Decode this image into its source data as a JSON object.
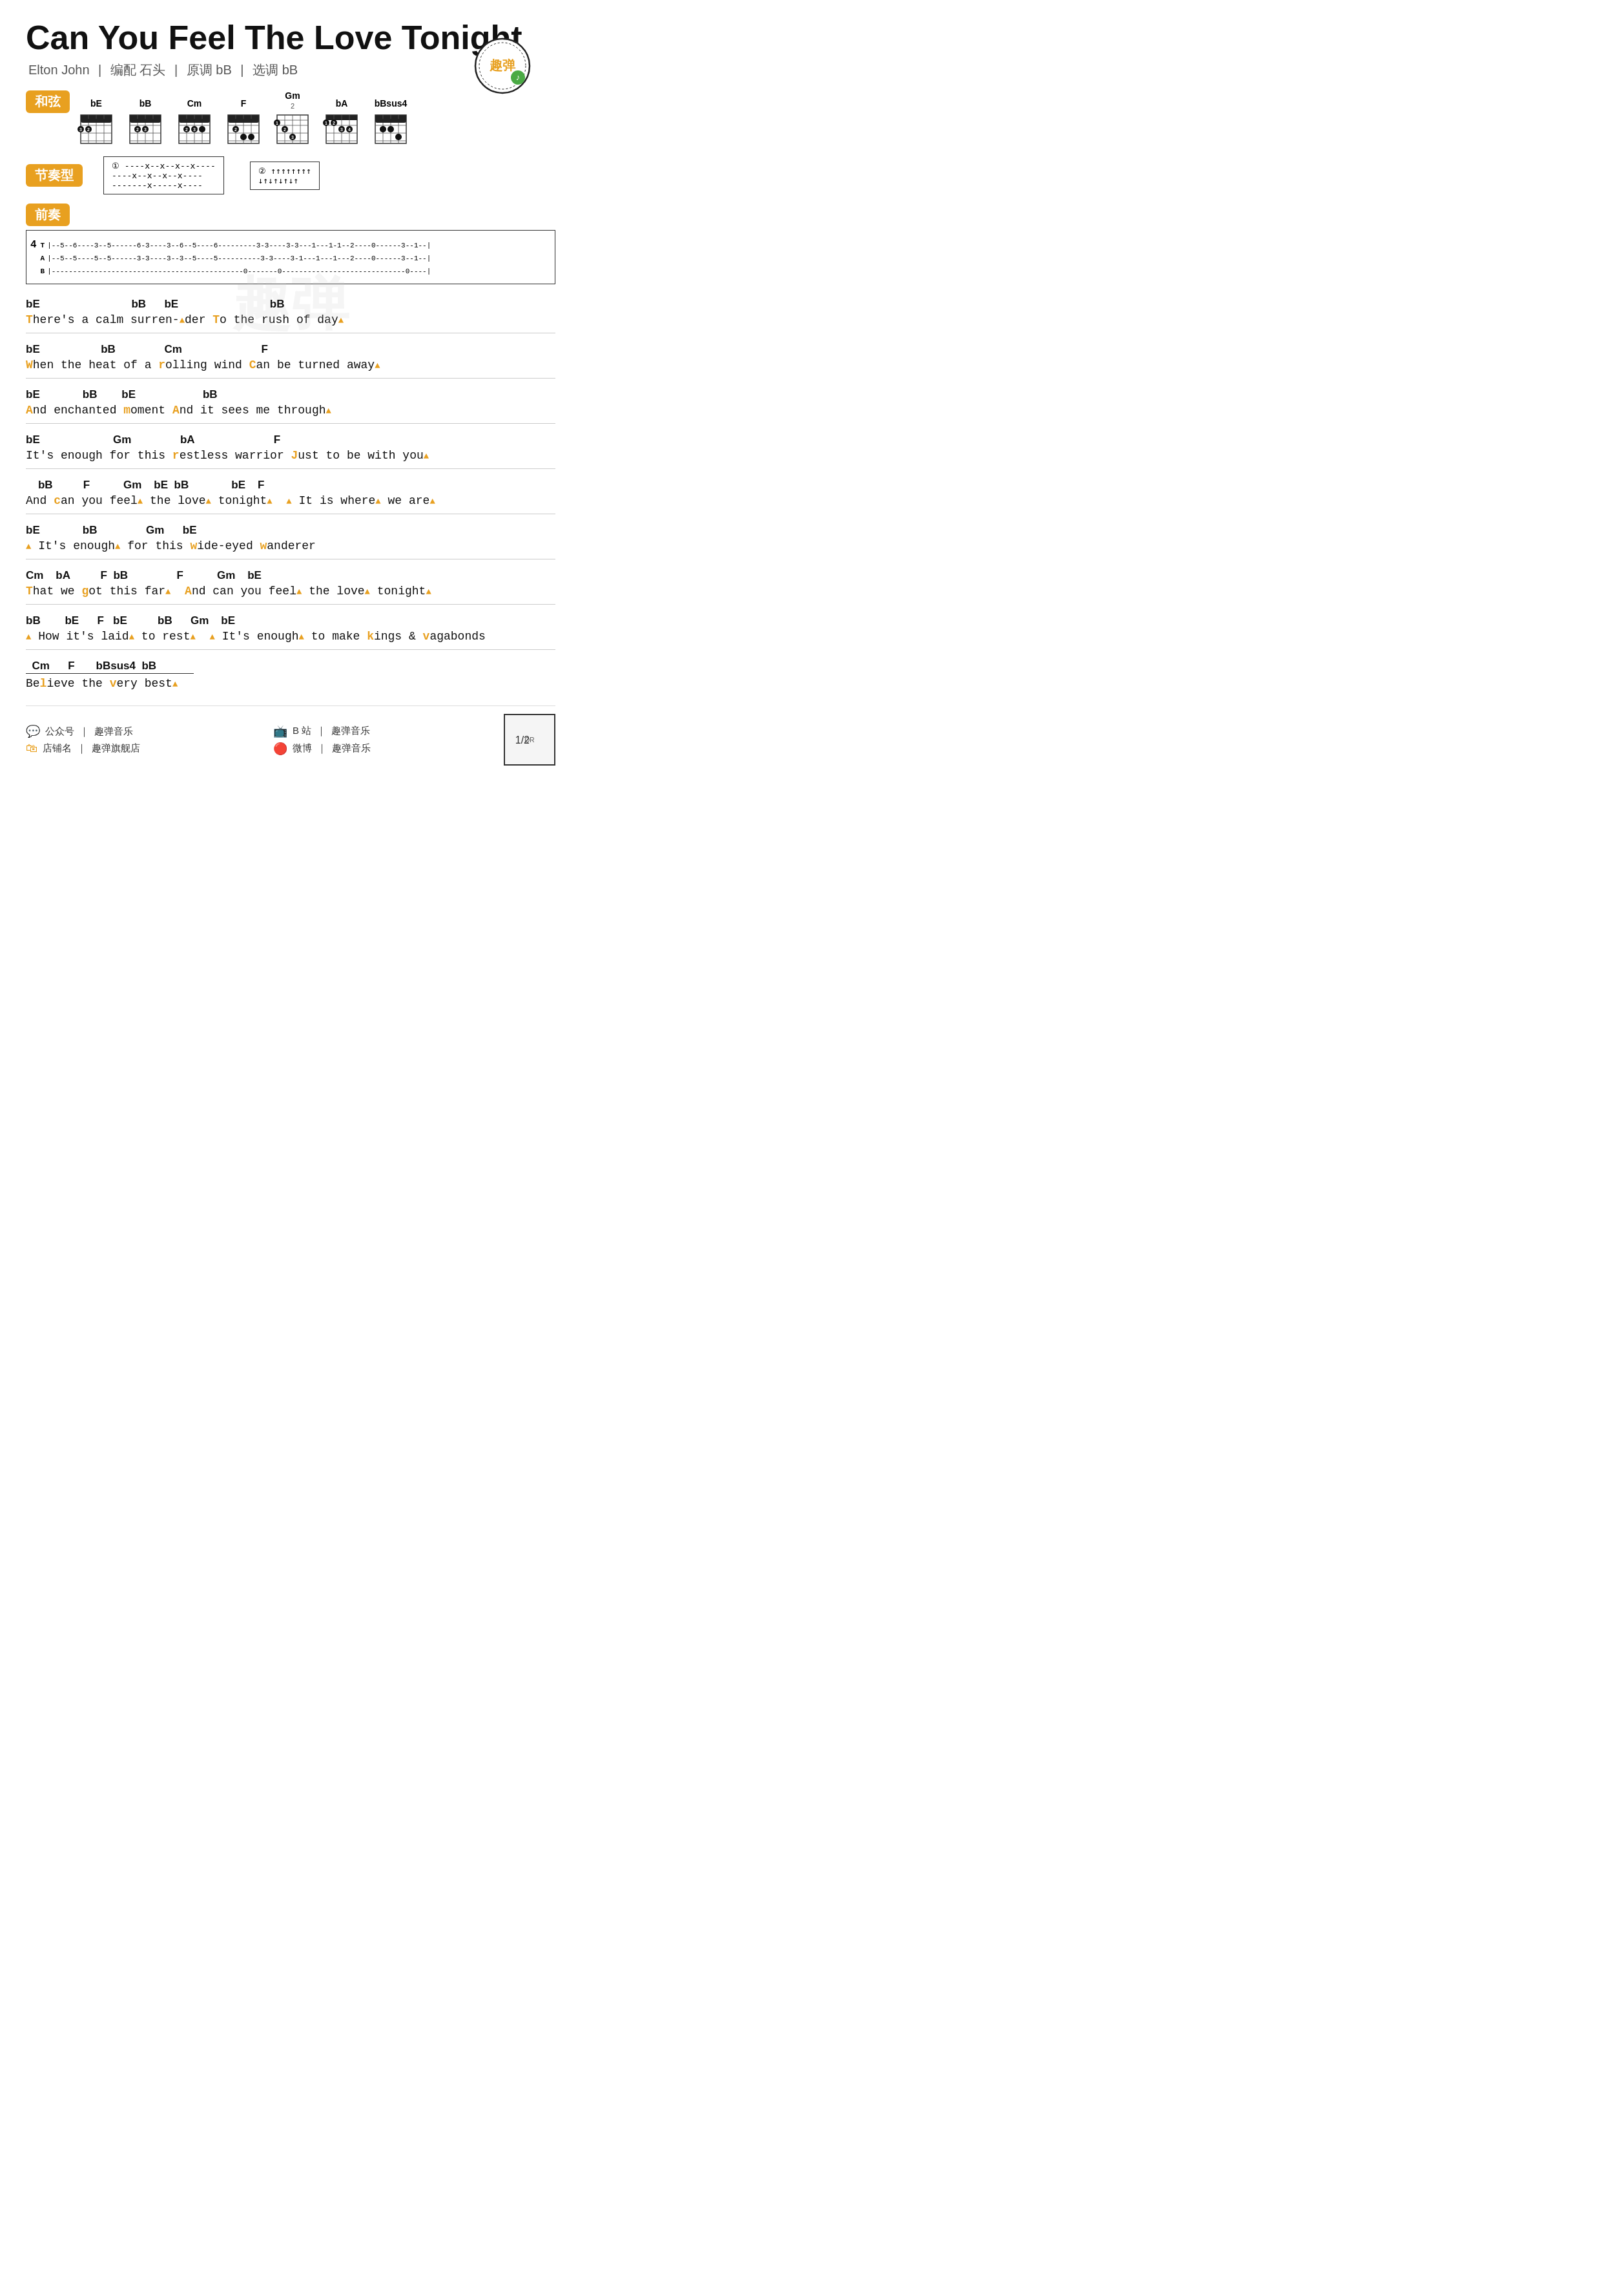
{
  "title": "Can You Feel The Love Tonight",
  "author": "Elton John",
  "arranger": "编配 石头",
  "original_key": "原调 bB",
  "selected_key": "选调 bB",
  "page_number": "1/2",
  "sections": {
    "chords_label": "和弦",
    "rhythm_label": "节奏型",
    "prelude_label": "前奏"
  },
  "chords": [
    {
      "name": "bE",
      "fret_offset": "",
      "fingers": []
    },
    {
      "name": "bB",
      "fret_offset": "",
      "fingers": []
    },
    {
      "name": "Cm",
      "fret_offset": "",
      "fingers": []
    },
    {
      "name": "F",
      "fret_offset": "",
      "fingers": []
    },
    {
      "name": "Gm",
      "fret_offset": "2",
      "fingers": []
    },
    {
      "name": "bA",
      "fret_offset": "",
      "fingers": []
    },
    {
      "name": "bBsus4",
      "fret_offset": "",
      "fingers": []
    }
  ],
  "lyrics": [
    {
      "chords": "bE                          bB      bE                          bB",
      "text": "There's a calm surren-▲der To the rush of day▲"
    },
    {
      "chords": "bE                  bB              Cm                          F",
      "text": "When the heat of a rolling wind Can be turned away▲"
    },
    {
      "chords": "bE              bB        bE                    bB",
      "text": "And enchanted moment And it sees me through▲"
    },
    {
      "chords": "bE                      Gm              bA                          F",
      "text": "It's enough for this restless warrior Just to be with you▲"
    },
    {
      "chords": "    bB          F           Gm      bE  bB              bE      F",
      "text": "And can you feel▲ the love▲ tonight▲  ▲ It is where▲ we are▲"
    },
    {
      "chords": "bE              bB              Gm      bE",
      "text": "▲ It's enough▲ for this wide-eyed wanderer"
    },
    {
      "chords": "Cm      bA          F   bB              F           Gm      bE",
      "text": "That we got this far▲  And can you feel▲ the love▲ tonight▲"
    },
    {
      "chords": "bB          bE      F   bE          bB      Gm      bE",
      "text": "▲ How it's laid▲ to rest▲  ▲ It's enough▲ to make kings & vagabonds"
    },
    {
      "chords": "  Cm      F       bBsus4  bB",
      "text": "Believe the very best▲"
    }
  ],
  "footer": {
    "wechat_icon": "微信",
    "wechat_label": "公众号",
    "wechat_name": "趣弹音乐",
    "taobao_label": "店铺名",
    "taobao_name": "趣弹旗舰店",
    "bilibili_label": "B 站",
    "bilibili_name": "趣弹音乐",
    "weibo_label": "微博",
    "weibo_name": "趣弹音乐"
  }
}
